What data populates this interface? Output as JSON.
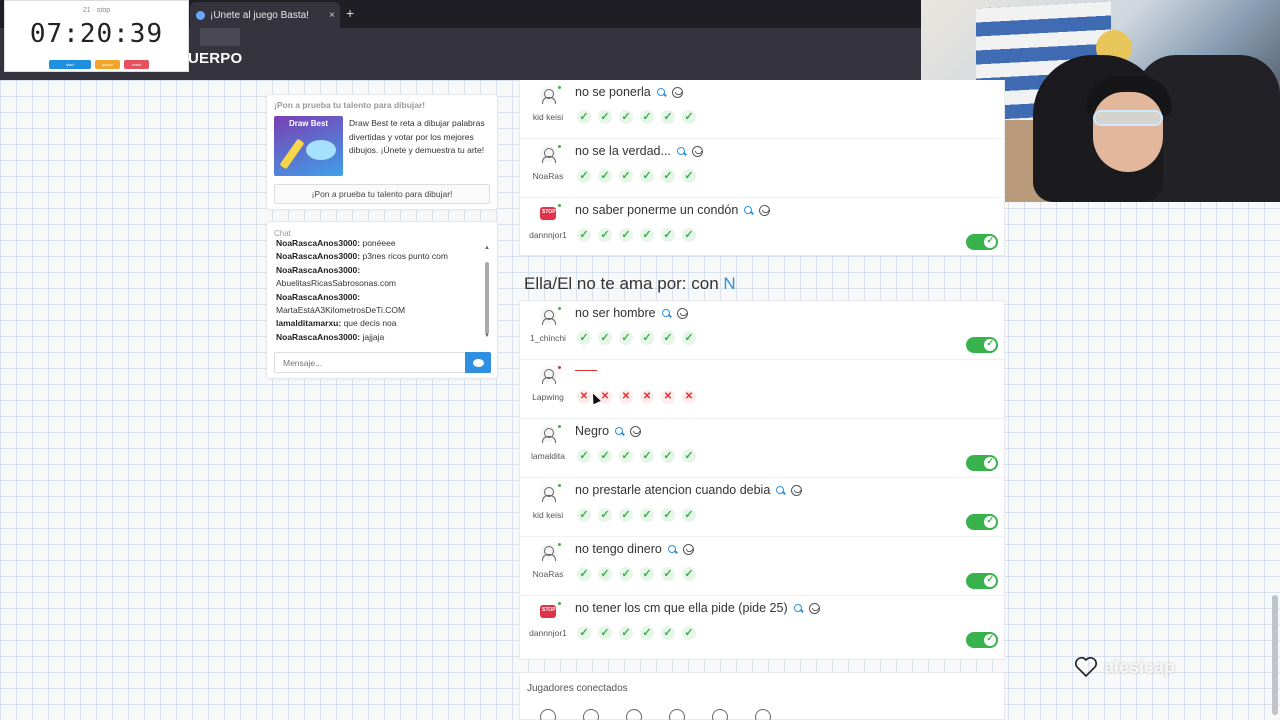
{
  "browser": {
    "tab_title": "¡Únete al juego Basta!",
    "tab_close": "×",
    "new_tab": "+",
    "site_logo": "UERPO"
  },
  "timer": {
    "label": "21 · stop",
    "value": "07:20:39",
    "buttons": [
      "start",
      "pause",
      "reset"
    ]
  },
  "promo": {
    "heading": "¡Pon a prueba tu talento para dibujar!",
    "image_title": "Draw Best",
    "text": "Draw Best te reta a dibujar palabras divertidas y votar por los mejores dibujos. ¡Únete y demuestra tu arte!",
    "button": "¡Pon a prueba tu talento para dibujar!"
  },
  "chat": {
    "title": "Chat",
    "messages": [
      {
        "user": "NoaRascaAnos3000:",
        "text": " ponéeee"
      },
      {
        "user": "NoaRascaAnos3000:",
        "text": " p3nes ricos punto com"
      },
      {
        "user": "NoaRascaAnos3000:",
        "text": ""
      },
      {
        "user": "",
        "text": "AbuelitasRicasSabrosonas.com"
      },
      {
        "user": "NoaRascaAnos3000:",
        "text": ""
      },
      {
        "user": "",
        "text": "MartaEstáA3KilometrosDeTi.COM"
      },
      {
        "user": "lamalditamarxu:",
        "text": " que decis noa"
      },
      {
        "user": "NoaRascaAnos3000:",
        "text": " jajjaja"
      }
    ],
    "input_placeholder": "Mensaje..."
  },
  "category_heading": {
    "text": "Ella/El no te ama por: con ",
    "letter": "N"
  },
  "rows_top": [
    {
      "player": "kid keisi",
      "answer": "no se ponerla",
      "avatar": "user",
      "status": "online",
      "votes": [
        "ok",
        "ok",
        "ok",
        "ok",
        "ok",
        "ok"
      ],
      "toggle": false
    },
    {
      "player": "NoaRas",
      "answer": "no se la verdad...",
      "avatar": "user",
      "status": "online",
      "votes": [
        "ok",
        "ok",
        "ok",
        "ok",
        "ok",
        "ok"
      ],
      "toggle": false
    },
    {
      "player": "dannnjor1",
      "answer": "no saber ponerme un condón",
      "avatar": "stop",
      "status": "online",
      "votes": [
        "ok",
        "ok",
        "ok",
        "ok",
        "ok",
        "ok"
      ],
      "toggle": true
    }
  ],
  "rows_bottom": [
    {
      "player": "1_chinchi",
      "answer": "no ser hombre",
      "avatar": "user",
      "status": "online",
      "votes": [
        "ok",
        "ok",
        "ok",
        "ok",
        "ok",
        "ok"
      ],
      "toggle": true
    },
    {
      "player": "Lapwing",
      "answer": "",
      "avatar": "user",
      "status": "offline",
      "votes": [
        "bad",
        "bad",
        "bad",
        "bad",
        "bad",
        "bad"
      ],
      "toggle": false
    },
    {
      "player": "lamaldita",
      "answer": "Negro",
      "avatar": "user",
      "status": "online",
      "votes": [
        "ok",
        "ok",
        "ok",
        "ok",
        "ok",
        "ok"
      ],
      "toggle": true
    },
    {
      "player": "kid keisi",
      "answer": "no prestarle atencion cuando debia",
      "avatar": "user",
      "status": "online",
      "votes": [
        "ok",
        "ok",
        "ok",
        "ok",
        "ok",
        "ok"
      ],
      "toggle": true
    },
    {
      "player": "NoaRas",
      "answer": "no tengo dinero",
      "avatar": "user",
      "status": "online",
      "votes": [
        "ok",
        "ok",
        "ok",
        "ok",
        "ok",
        "ok"
      ],
      "toggle": true
    },
    {
      "player": "dannnjor1",
      "answer": "no tener los cm que ella pide (pide 25)",
      "avatar": "stop",
      "status": "online",
      "votes": [
        "ok",
        "ok",
        "ok",
        "ok",
        "ok",
        "ok"
      ],
      "toggle": true
    }
  ],
  "stop_badge": "STOP",
  "players_section": {
    "title": "Jugadores conectados",
    "count_visible": 6
  },
  "watermark": {
    "text": "alesicap"
  },
  "colors": {
    "accent": "#2f8fe0",
    "success": "#37b24d",
    "danger": "#e03131",
    "topbar": "#35333d"
  }
}
